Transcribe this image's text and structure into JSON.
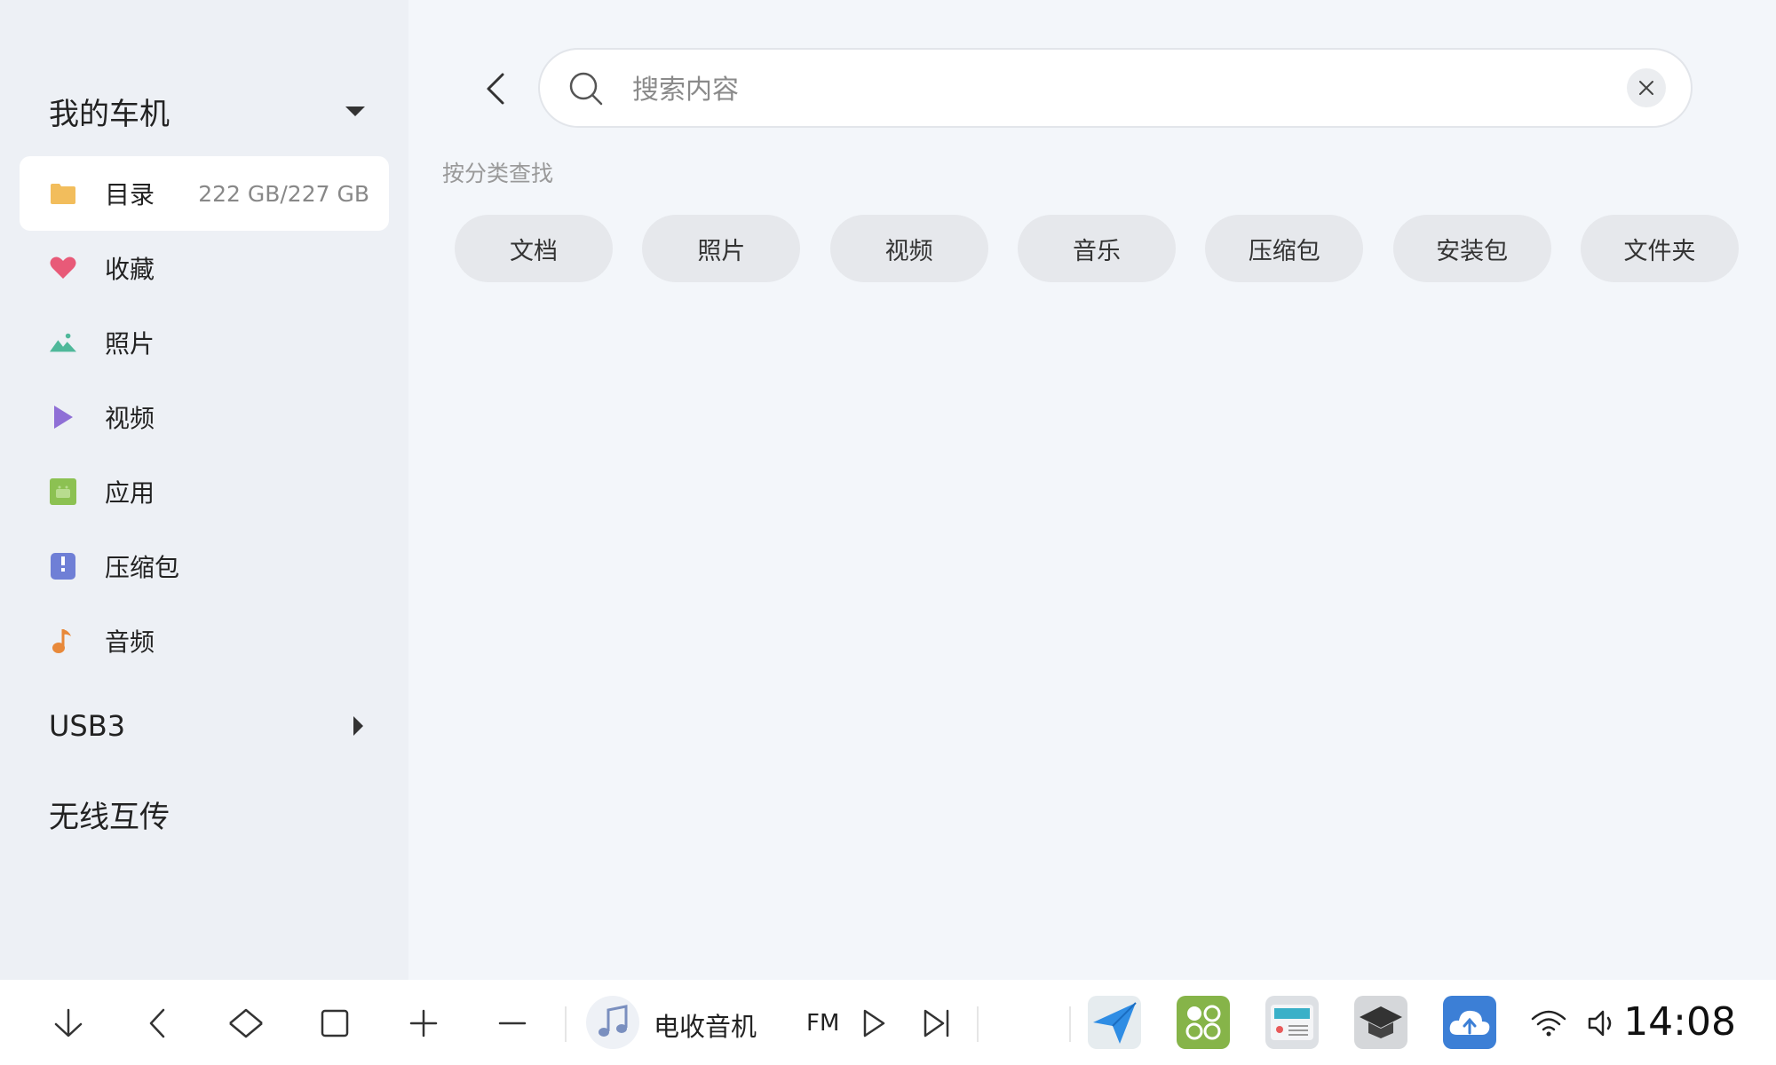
{
  "sidebar": {
    "device_title": "我的车机",
    "items": [
      {
        "label": "目录",
        "meta": "222 GB/227 GB",
        "icon": "folder-icon",
        "color": "#f2bd5c",
        "active": true
      },
      {
        "label": "收藏",
        "icon": "heart-icon",
        "color": "#e85a78"
      },
      {
        "label": "照片",
        "icon": "image-icon",
        "color": "#4fb89a"
      },
      {
        "label": "视频",
        "icon": "play-icon",
        "color": "#8f6fd6"
      },
      {
        "label": "应用",
        "icon": "android-icon",
        "color": "#8cc152"
      },
      {
        "label": "压缩包",
        "icon": "archive-icon",
        "color": "#6f7fd6"
      },
      {
        "label": "音频",
        "icon": "music-note-icon",
        "color": "#e8893a"
      }
    ],
    "usb_title": "USB3",
    "wireless_label": "无线互传"
  },
  "search": {
    "placeholder": "搜索内容",
    "value": ""
  },
  "categories": {
    "title": "按分类查找",
    "chips": [
      "文档",
      "照片",
      "视频",
      "音乐",
      "压缩包",
      "安装包",
      "文件夹"
    ]
  },
  "taskbar": {
    "media_title": "电收音机",
    "media_sub": "FM",
    "apps": [
      "navigation-app-icon",
      "app-center-icon",
      "radio-app-icon",
      "education-app-icon",
      "ota-update-icon"
    ],
    "time": "14:08"
  }
}
